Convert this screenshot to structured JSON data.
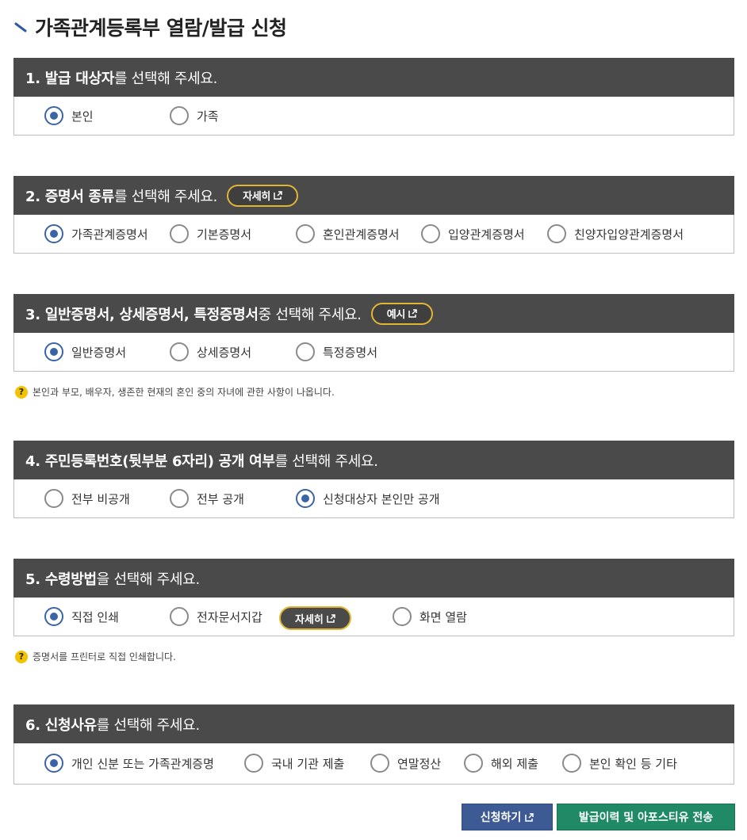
{
  "page": {
    "title": "가족관계등록부 열람/발급 신청"
  },
  "sections": [
    {
      "head_bold": "1. 발급 대상자",
      "head_rest": "를 선택해 주세요.",
      "options": [
        {
          "label": "본인",
          "selected": true
        },
        {
          "label": "가족",
          "selected": false
        }
      ]
    },
    {
      "head_bold": "2. 증명서 종류",
      "head_rest": "를 선택해 주세요.",
      "pill_label": "자세히",
      "options": [
        {
          "label": "가족관계증명서",
          "selected": true
        },
        {
          "label": "기본증명서",
          "selected": false
        },
        {
          "label": "혼인관계증명서",
          "selected": false
        },
        {
          "label": "입양관계증명서",
          "selected": false
        },
        {
          "label": "친양자입양관계증명서",
          "selected": false
        }
      ]
    },
    {
      "head_bold": "3. 일반증명서, 상세증명서, 특정증명서",
      "head_rest": " 중 선택해 주세요.",
      "pill_label": "예시",
      "options": [
        {
          "label": "일반증명서",
          "selected": true
        },
        {
          "label": "상세증명서",
          "selected": false
        },
        {
          "label": "특정증명서",
          "selected": false
        }
      ],
      "note": "본인과 부모, 배우자, 생존한 현재의 혼인 중의 자녀에 관한 사항이 나옵니다."
    },
    {
      "head_bold": "4. 주민등록번호(뒷부분 6자리) 공개 여부",
      "head_rest": "를 선택해 주세요.",
      "options": [
        {
          "label": "전부 비공개",
          "selected": false
        },
        {
          "label": "전부 공개",
          "selected": false
        },
        {
          "label": "신청대상자 본인만 공개",
          "selected": true
        }
      ]
    },
    {
      "head_bold": "5. 수령방법",
      "head_rest": "을 선택해 주세요.",
      "pill_label": "자세히",
      "options": [
        {
          "label": "직접 인쇄",
          "selected": true
        },
        {
          "label": "전자문서지갑",
          "selected": false
        },
        {
          "label": "화면 열람",
          "selected": false
        }
      ],
      "note": "증명서를 프린터로 직접 인쇄합니다."
    },
    {
      "head_bold": "6. 신청사유",
      "head_rest": "를 선택해 주세요.",
      "options": [
        {
          "label": "개인 신분 또는 가족관계증명",
          "selected": true
        },
        {
          "label": "국내 기관 제출",
          "selected": false
        },
        {
          "label": "연말정산",
          "selected": false
        },
        {
          "label": "해외 제출",
          "selected": false
        },
        {
          "label": "본인 확인 등 기타",
          "selected": false
        }
      ]
    }
  ],
  "buttons": {
    "apply": "신청하기",
    "send": "발급이력 및 아포스티유 전송"
  },
  "colors": {
    "header_bg": "#4a4a4a",
    "radio_selected": "#3b64a6",
    "pill_border": "#e1b534",
    "apply_btn": "#3e5a94",
    "send_btn": "#1f8a65"
  },
  "icons": {
    "title": "diagonal-slash-icon",
    "external": "external-link-icon",
    "help": "question-icon",
    "radio": "radio-icon"
  }
}
